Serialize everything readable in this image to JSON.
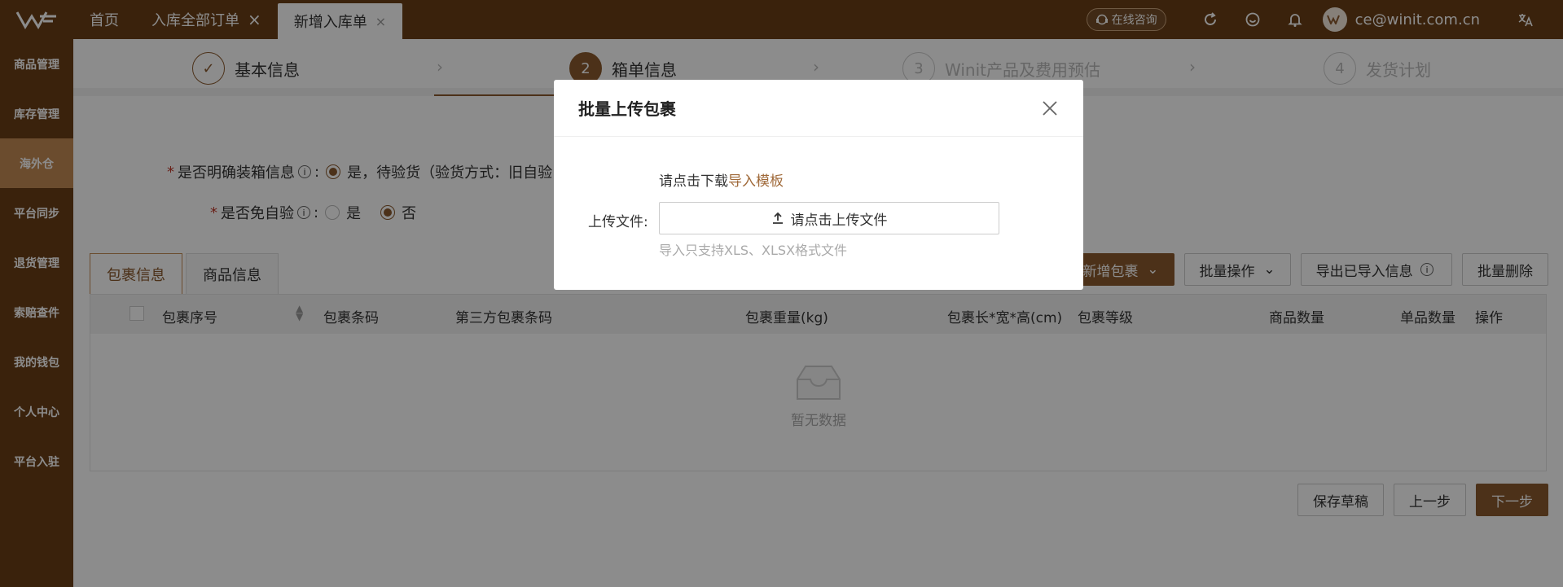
{
  "topbar": {
    "tabs": [
      {
        "label": "首页",
        "closable": false
      },
      {
        "label": "入库全部订单",
        "closable": true
      },
      {
        "label": "新增入库单",
        "closable": true
      }
    ],
    "consult_label": "在线咨询",
    "user_email": "ce@winit.com.cn"
  },
  "sidebar": {
    "items": [
      {
        "label": "商品管理"
      },
      {
        "label": "库存管理"
      },
      {
        "label": "海外仓"
      },
      {
        "label": "平台同步"
      },
      {
        "label": "退货管理"
      },
      {
        "label": "索赔查件"
      },
      {
        "label": "我的钱包"
      },
      {
        "label": "个人中心"
      },
      {
        "label": "平台入驻"
      }
    ]
  },
  "steps": [
    {
      "num": "✓",
      "label": "基本信息"
    },
    {
      "num": "2",
      "label": "箱单信息"
    },
    {
      "num": "3",
      "label": "Winit产品及费用预估"
    },
    {
      "num": "4",
      "label": "发货计划"
    }
  ],
  "form": {
    "row1": {
      "label": "是否明确装箱信息",
      "option": "是，待验货（验货方式：旧自验"
    },
    "row2": {
      "label": "是否免自验",
      "yes": "是",
      "no": "否"
    }
  },
  "panel_tabs": [
    "包裹信息",
    "商品信息"
  ],
  "actions": {
    "add": "新增包裹",
    "batch": "批量操作",
    "export": "导出已导入信息",
    "delete": "批量删除"
  },
  "table": {
    "columns": [
      "包裹序号",
      "包裹条码",
      "第三方包裹条码",
      "包裹重量(kg)",
      "包裹长*宽*高(cm)",
      "包裹等级",
      "商品数量",
      "单品数量",
      "操作"
    ],
    "empty": "暂无数据"
  },
  "bottom": {
    "save": "保存草稿",
    "prev": "上一步",
    "next": "下一步"
  },
  "modal": {
    "title": "批量上传包裹",
    "hint_prefix": "请点击下载",
    "hint_link": "导入模板",
    "upload_label": "上传文件:",
    "upload_button": "请点击上传文件",
    "note": "导入只支持XLS、XLSX格式文件"
  }
}
